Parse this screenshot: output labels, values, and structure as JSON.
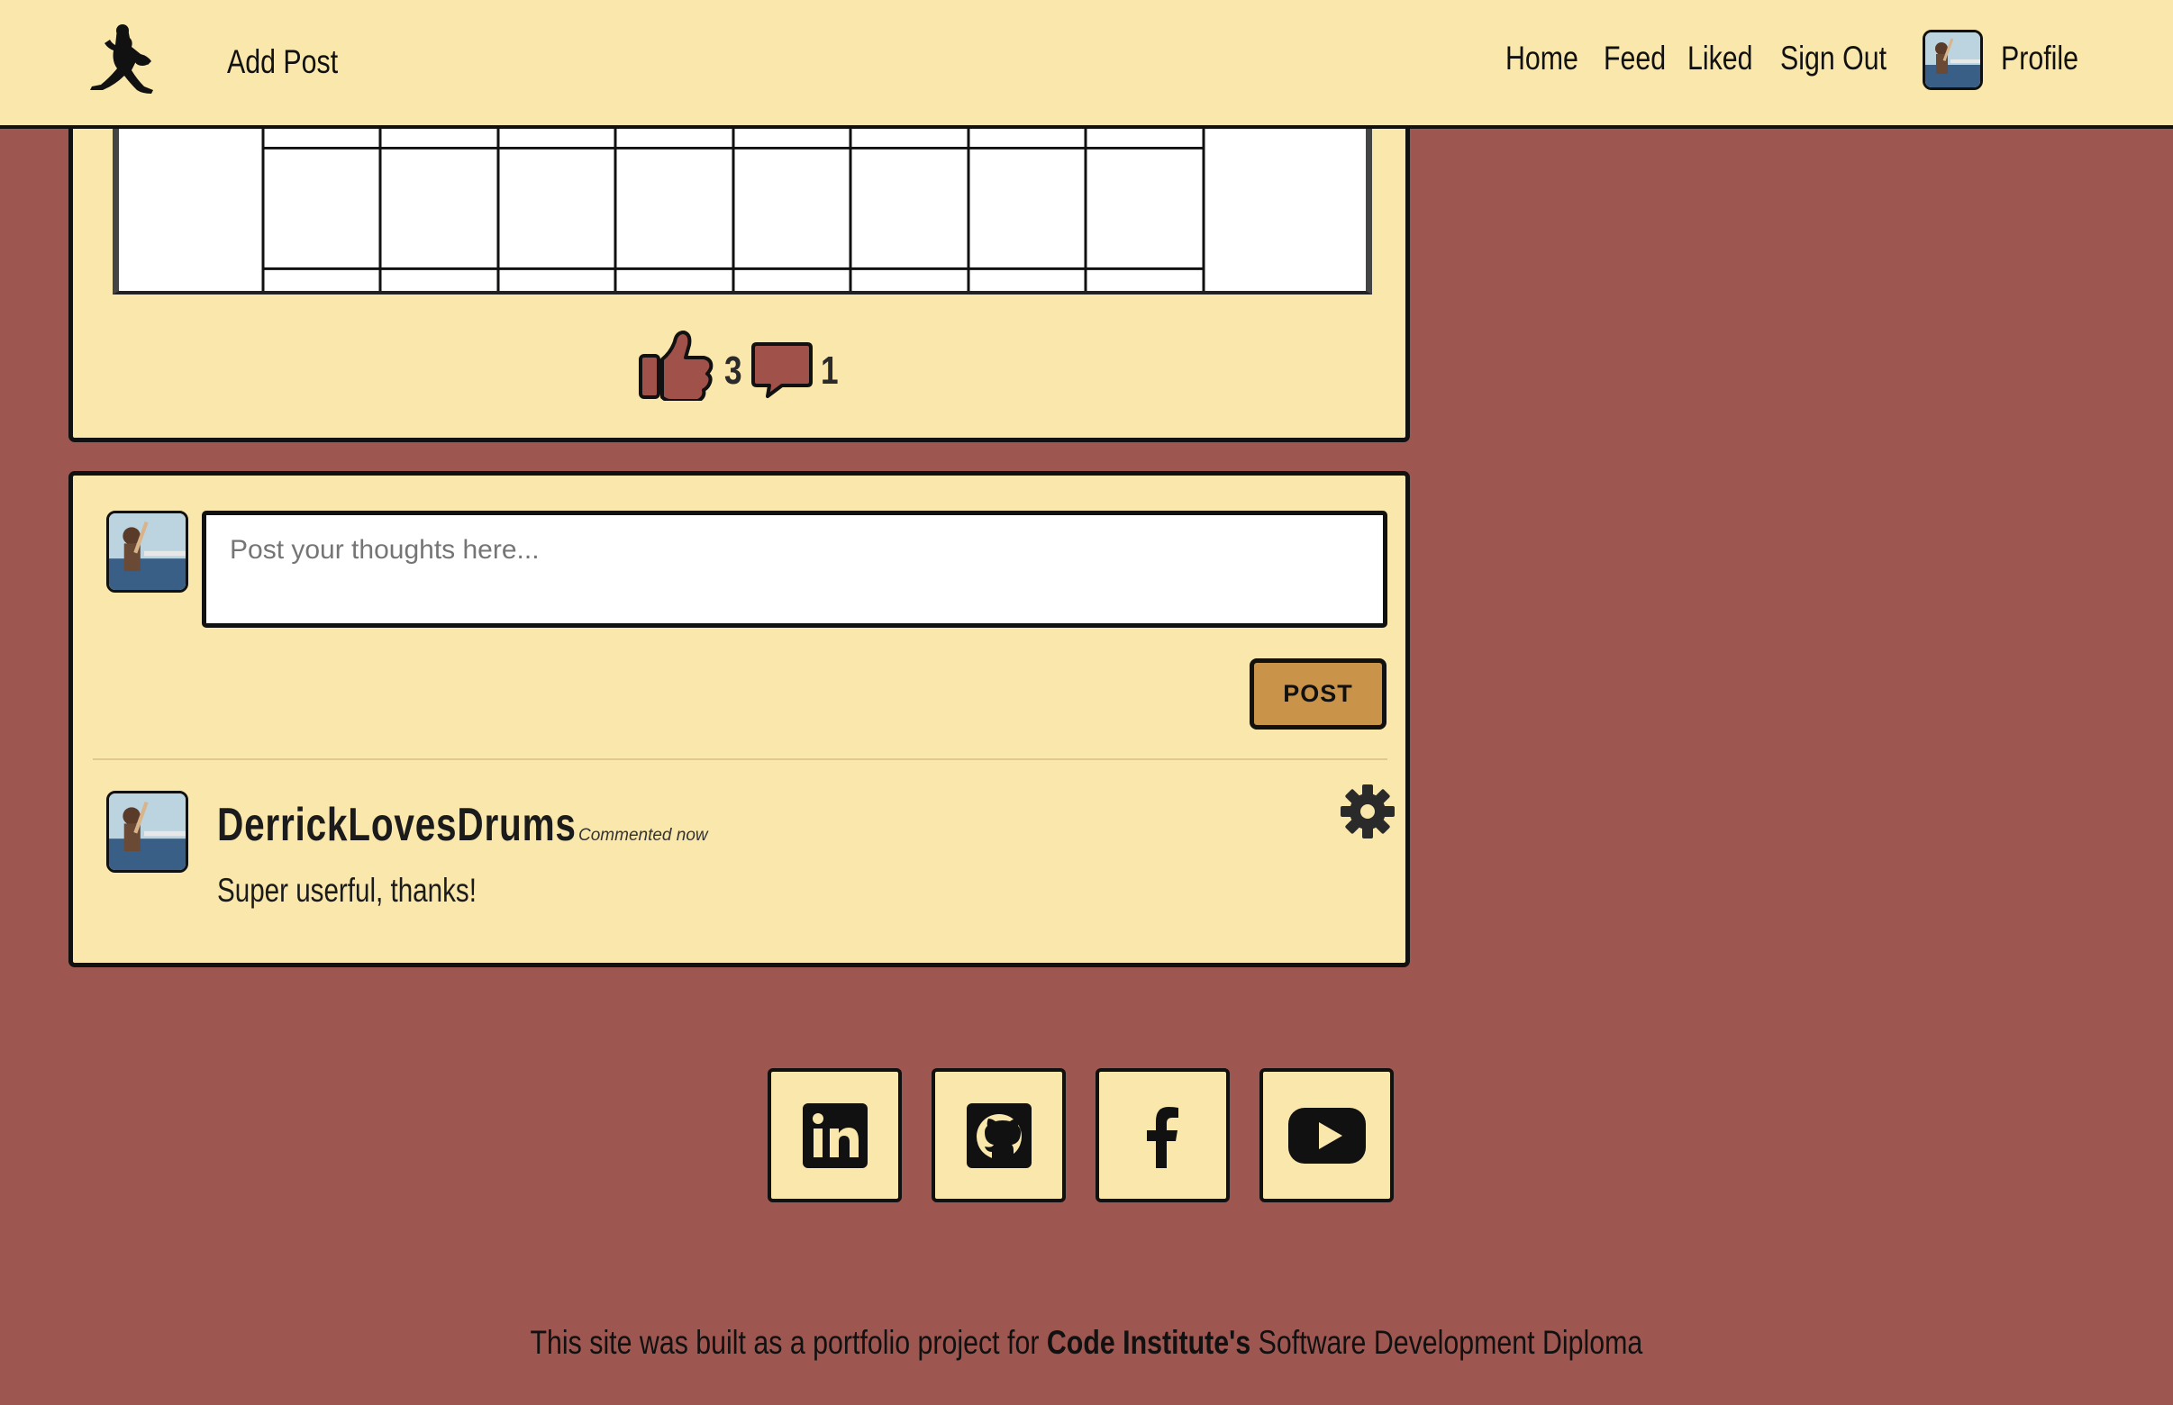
{
  "navbar": {
    "add_post": "Add Post",
    "links": [
      "Home",
      "Feed",
      "Liked",
      "Sign Out"
    ],
    "profile": "Profile"
  },
  "post": {
    "likes": "3",
    "comments": "1"
  },
  "comment_form": {
    "placeholder": "Post your thoughts here...",
    "submit_label": "POST"
  },
  "comment": {
    "author": "DerrickLovesDrums",
    "time": "Commented now",
    "body": "Super userful, thanks!"
  },
  "social": [
    "linkedin-icon",
    "github-icon",
    "facebook-icon",
    "youtube-icon"
  ],
  "footer": {
    "prefix": "This site was built as a portfolio project for ",
    "bold": "Code Institute's",
    "suffix": " Software Development Diploma"
  },
  "colors": {
    "background": "#9e5650",
    "card": "#fae7ab",
    "accent": "#c9944a",
    "icon_fill": "#a0514a"
  }
}
